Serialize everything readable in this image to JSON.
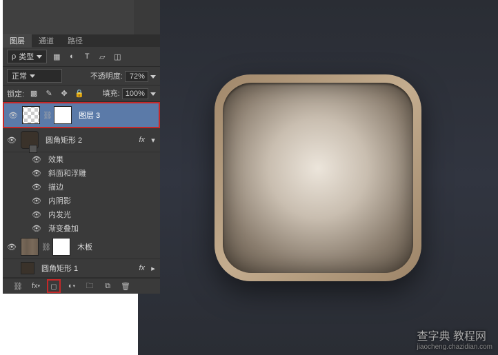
{
  "tabs": {
    "layers": "图层",
    "channels": "通道",
    "paths": "路径"
  },
  "filter": {
    "kind_label": "类型"
  },
  "blend": {
    "mode": "正常",
    "opacity_label": "不透明度:",
    "opacity_value": "72%"
  },
  "lock": {
    "label": "锁定:",
    "fill_label": "填充:",
    "fill_value": "100%"
  },
  "layers": {
    "l0": {
      "name": "图层 3"
    },
    "l1": {
      "name": "圆角矩形 2",
      "fx": "fx"
    },
    "fx_header": "效果",
    "fx_items": [
      "斜面和浮雕",
      "描边",
      "内阴影",
      "内发光",
      "渐变叠加"
    ],
    "l2": {
      "name": "木板"
    },
    "l3": {
      "name": "圆角矩形 1",
      "fx": "fx"
    }
  },
  "watermark": {
    "main": "查字典 教程网",
    "sub": "jiaocheng.chazidian.com"
  }
}
